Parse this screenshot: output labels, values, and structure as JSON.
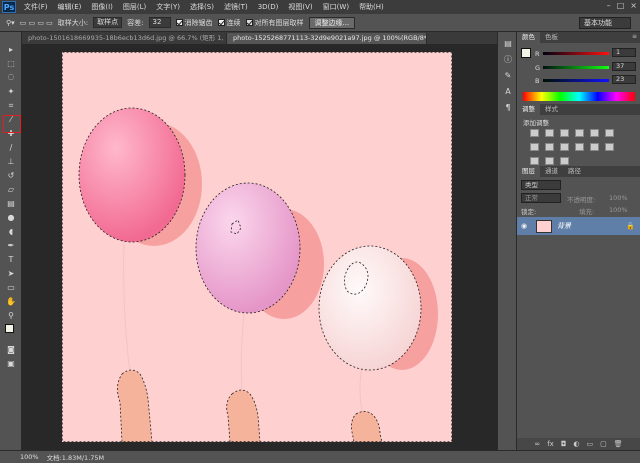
{
  "app": {
    "logo": "Ps"
  },
  "menu": [
    "文件(F)",
    "编辑(E)",
    "图像(I)",
    "图层(L)",
    "文字(Y)",
    "选择(S)",
    "滤镜(T)",
    "3D(D)",
    "视图(V)",
    "窗口(W)",
    "帮助(H)"
  ],
  "window_controls": [
    "–",
    "□",
    "×"
  ],
  "options": {
    "sample_size_label": "取样大小:",
    "sample_size_value": "取样点",
    "tolerance_label": "容差:",
    "tolerance_value": "32",
    "antialias_label": "消除锯齿",
    "contiguous_label": "连续",
    "sample_all_label": "对所有图层取样",
    "refine_edge_label": "调整边缘...",
    "workspace": "基本功能"
  },
  "doc_tabs": [
    {
      "title": "photo-1501618669935-18b6ecb13d6d.jpg @ 66.7% (矩形 1, RGB/8*) *",
      "active": false
    },
    {
      "title": "photo-1525268771113-32d9e9021a97.jpg @ 100%(RGB/8*)",
      "active": true
    }
  ],
  "status": {
    "zoom": "100%",
    "doc": "文档:1.83M/1.75M"
  },
  "color_panel": {
    "tabs": [
      "颜色",
      "色板"
    ],
    "channels": [
      {
        "label": "R",
        "value": "1"
      },
      {
        "label": "G",
        "value": "37"
      },
      {
        "label": "B",
        "value": "23"
      }
    ]
  },
  "adjust_panel": {
    "tabs": [
      "调整",
      "样式"
    ],
    "title": "添加调整"
  },
  "layers_panel": {
    "tabs": [
      "图层",
      "通道",
      "路径"
    ],
    "kind": "类型",
    "blend": "正常",
    "opacity_label": "不透明度:",
    "opacity_value": "100%",
    "lock_label": "锁定:",
    "fill_label": "填充:",
    "fill_value": "100%",
    "layers": [
      {
        "name": "背景",
        "locked": true
      }
    ]
  },
  "colors": {
    "canvas_bg": "#ffd0d0",
    "highlight": "#e02020",
    "layer_selected": "#5f7fa8"
  }
}
